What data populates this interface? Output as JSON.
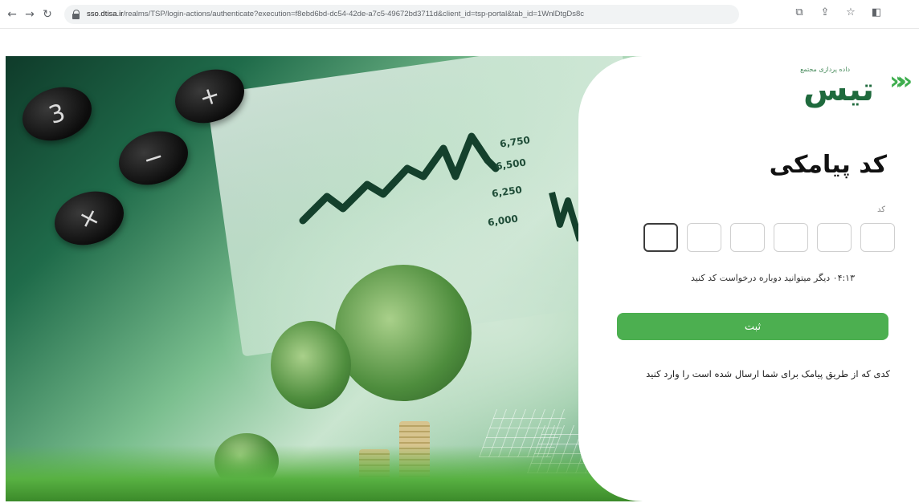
{
  "browser": {
    "url_host": "sso.dtisa.ir",
    "url_path": "/realms/TSP/login-actions/authenticate?execution=f8ebd6bd-dc54-42de-a7c5-49672bd3711d&client_id=tsp-portal&tab_id=1WnlDtgDs8c",
    "icons": [
      "back-arrow",
      "forward-arrow",
      "reload",
      "lock",
      "translate",
      "share",
      "star",
      "side-panel"
    ]
  },
  "hero": {
    "calc_keys": [
      "3",
      "+",
      "−",
      "×"
    ],
    "chart_ticks": [
      "6,750",
      "6,500",
      "6,250",
      "6,000"
    ]
  },
  "card": {
    "logo_text": "تیس",
    "logo_sub": "داده پردازی مجتمع",
    "title": "کد پیامکی",
    "code_label": "کد",
    "otp_boxes": 6,
    "timer_text": "۰۴:۱۳ دیگر میتوانید دوباره درخواست کد کنید",
    "submit_label": "ثبت",
    "hint": "کدی که از طریق پیامک برای شما ارسال شده است را وارد کنید"
  },
  "colors": {
    "accent_green": "#4caf50",
    "logo_green": "#1f6a3d"
  }
}
